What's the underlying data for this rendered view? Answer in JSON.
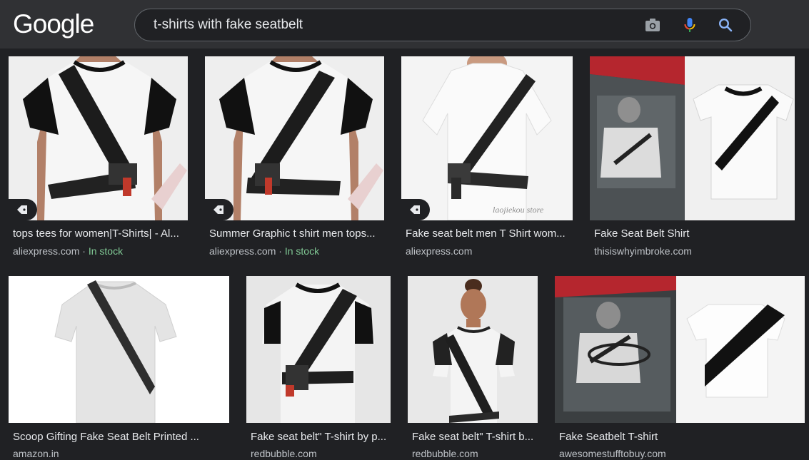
{
  "header": {
    "logo_text": "Google",
    "search": {
      "query": "t-shirts with fake seatbelt"
    },
    "icons": {
      "camera": "camera-icon",
      "mic": "microphone-icon",
      "search": "search-icon"
    },
    "colors": {
      "mic_blue": "#4285f4",
      "mic_red": "#ea4335",
      "mic_yellow": "#fbbc04",
      "mic_green": "#34a853",
      "search_blue": "#8ab4f8"
    }
  },
  "results": {
    "row1": [
      {
        "title": "tops tees for women|T-Shirts| - Al...",
        "source": "aliexpress.com",
        "separator": " · ",
        "stock": "In stock",
        "has_tag": true
      },
      {
        "title": "Summer Graphic t shirt men tops...",
        "source": "aliexpress.com",
        "separator": " · ",
        "stock": "In stock",
        "has_tag": true
      },
      {
        "title": "Fake seat belt men T Shirt wom...",
        "source": "aliexpress.com",
        "watermark": "laojiekou store",
        "has_tag": true
      },
      {
        "title": "Fake Seat Belt Shirt",
        "source": "thisiswhyimbroke.com",
        "has_tag": false
      }
    ],
    "row2": [
      {
        "title": "Scoop Gifting Fake Seat Belt Printed ...",
        "source": "amazon.in"
      },
      {
        "title": "Fake seat belt\" T-shirt by p...",
        "source": "redbubble.com"
      },
      {
        "title": "Fake seat belt\" T-shirt b...",
        "source": "redbubble.com"
      },
      {
        "title": "Fake Seatbelt T-shirt",
        "source": "awesomestufftobuy.com"
      }
    ]
  }
}
